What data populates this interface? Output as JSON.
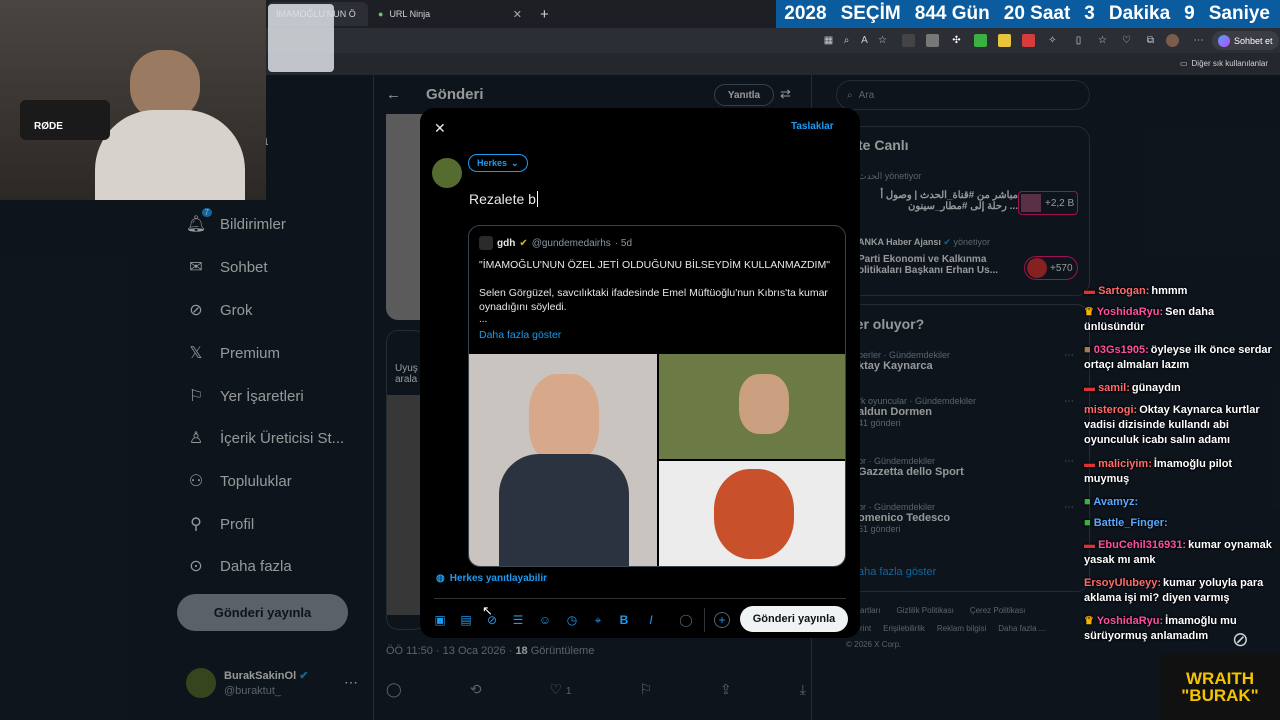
{
  "browser": {
    "tabs": [
      {
        "label": "İMAMOĞLU'NUN Ö"
      },
      {
        "label": "URL Ninja"
      }
    ],
    "new_tab": "+",
    "countdown": [
      "2028",
      "SEÇİM",
      "844 Gün",
      "20 Saat",
      "3",
      "Dakika",
      "9",
      "Saniye"
    ],
    "copilot_label": "Sohbet et",
    "bookmarks_label": "Diğer sık kullanılanlar"
  },
  "webcam": {
    "mic_brand": "RØDE"
  },
  "sidebar": {
    "partial_label": "yfa",
    "items": [
      {
        "label": "Bildirimler",
        "icon": "bell-icon",
        "badge": "7"
      },
      {
        "label": "Sohbet",
        "icon": "mail-icon"
      },
      {
        "label": "Grok",
        "icon": "grok-icon"
      },
      {
        "label": "Premium",
        "icon": "x-logo-icon"
      },
      {
        "label": "Yer İşaretleri",
        "icon": "bookmark-icon"
      },
      {
        "label": "İçerik Üreticisi St...",
        "icon": "creator-icon"
      },
      {
        "label": "Topluluklar",
        "icon": "communities-icon"
      },
      {
        "label": "Profil",
        "icon": "person-icon"
      },
      {
        "label": "Daha fazla",
        "icon": "more-circle-icon"
      }
    ],
    "post_button": "Gönderi yayınla",
    "account": {
      "name": "BurakSakinOl",
      "handle": "@buraktut_"
    }
  },
  "center": {
    "title": "Gönderi",
    "reply_button": "Yanıtla",
    "partial_snippet": [
      "Uyuş",
      "arala"
    ],
    "timestamp": "ÖÖ 11:50 · 13 Oca 2026 ·",
    "views_count": "18",
    "views_label": "Görüntüleme",
    "like_count": "1"
  },
  "right": {
    "search_placeholder": "Ara",
    "live_title": "te Canlı",
    "live_items": [
      {
        "source": "الحدث",
        "status": "yönetiyor",
        "text1": "مباشر من #قناة_الحدث | وصول أ",
        "text2": "رحلة إلى #مطار_سينون ...",
        "count": "+2,2 B"
      },
      {
        "source": "ANKA Haber Ajansı",
        "status": "yönetiyor",
        "text1": "Parti Ekonomi ve Kalkınma",
        "text2": "olitikaları Başkanı Erhan Us...",
        "count": "+570"
      }
    ],
    "trends_title": "eler oluyor?",
    "trends": [
      {
        "meta": "berler · Gündemdekiler",
        "name": "ktay Kaynarca",
        "posts": ""
      },
      {
        "meta": "rk oyuncular · Gündemdekiler",
        "name": "aldun Dormen",
        "posts": "41 gönderi"
      },
      {
        "meta": "or · Gündemdekiler",
        "name": "Gazzetta dello Sport",
        "posts": ""
      },
      {
        "meta": "or · Gündemdekiler",
        "name": "omenico Tedesco",
        "posts": "61 gönderi"
      }
    ],
    "show_more": "aha fazla göster",
    "footer": [
      "n Şartları",
      "Gizlilik Politikası",
      "Çerez Politikası",
      "rint",
      "Erişilebilirlik",
      "Reklam bilgisi",
      "Daha fazla ...",
      "2026 X Corp."
    ]
  },
  "composer": {
    "drafts_label": "Taslaklar",
    "audience": "Herkes",
    "text": "Rezalete b",
    "reply_setting": "Herkes yanıtlayabilir",
    "submit": "Gönderi yayınla",
    "quote": {
      "name": "gdh",
      "handle": "@gundemedairhs",
      "age": "· 5d",
      "headline": "\"İMAMOĞLU'NUN ÖZEL JETİ OLDUĞUNU BİLSEYDİM KULLANMAZDIM\"",
      "body": "Selen Görgüzel, savcılıktaki ifadesinde Emel Müftüoğlu'nun Kıbrıs'ta kumar oynadığını söyledi.",
      "ellipsis": "...",
      "show_more": "Daha fazla göster"
    }
  },
  "chat": [
    {
      "user": "Sartogan:",
      "color": "#ff6b6b",
      "msg": "hmmm"
    },
    {
      "user": "YoshidaRyu:",
      "color": "#ff4fa0",
      "msg": "Sen daha ünlüsündür"
    },
    {
      "user": "03Gs1905:",
      "color": "#ff4fa0",
      "msg": "öyleyse ilk önce serdar ortaçı almaları lazım"
    },
    {
      "user": "samil:",
      "color": "#ff6b6b",
      "msg": "günaydın"
    },
    {
      "user": "misterogi:",
      "color": "#ff6b6b",
      "msg": "Oktay Kaynarca kurtlar vadisi dizisinde kullandı abi oyunculuk icabı salın adamı"
    },
    {
      "user": "maliciyim:",
      "color": "#ff6b6b",
      "msg": "İmamoğlu pilot muymuş"
    },
    {
      "user": "Avamyz:",
      "color": "#5aa9ff",
      "msg": ""
    },
    {
      "user": "Battle_Finger:",
      "color": "#5aa9ff",
      "msg": ""
    },
    {
      "user": "EbuCehil316931:",
      "color": "#ff4fa0",
      "msg": "kumar oynamak yasak mı amk"
    },
    {
      "user": "ErsoyUlubeyy:",
      "color": "#ff6b6b",
      "msg": "kumar yoluyla para aklama işi mi? diyen varmış"
    },
    {
      "user": "YoshidaRyu:",
      "color": "#ff4fa0",
      "msg": "İmamoğlu mu sürüyormuş anlamadım"
    }
  ],
  "logo": {
    "line1": "WRAITH",
    "line2": "\"BURAK\""
  }
}
